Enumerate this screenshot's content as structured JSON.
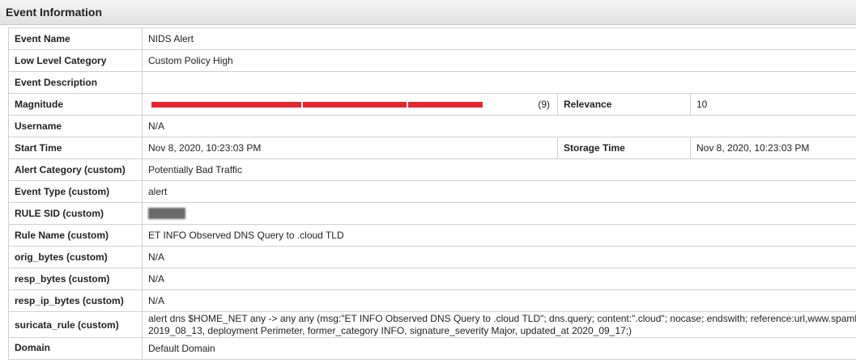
{
  "header": {
    "title": "Event Information"
  },
  "event": {
    "event_name_label": "Event Name",
    "event_name": "NIDS Alert",
    "low_level_category_label": "Low Level Category",
    "low_level_category": "Custom Policy High",
    "event_description_label": "Event Description",
    "event_description": "",
    "magnitude_label": "Magnitude",
    "magnitude_value": "(9)",
    "magnitude_level": 9,
    "magnitude_color": "#e8262e",
    "relevance_label": "Relevance",
    "relevance": "10",
    "username_label": "Username",
    "username": "N/A",
    "start_time_label": "Start Time",
    "start_time": "Nov 8, 2020, 10:23:03 PM",
    "storage_time_label": "Storage Time",
    "storage_time": "Nov 8, 2020, 10:23:03 PM",
    "alert_category_label": "Alert Category (custom)",
    "alert_category": "Potentially Bad Traffic",
    "event_type_label": "Event Type (custom)",
    "event_type": "alert",
    "rule_sid_label": "RULE SID (custom)",
    "rule_name_label": "Rule Name (custom)",
    "rule_name": "ET INFO Observed DNS Query to .cloud TLD",
    "orig_bytes_label": "orig_bytes (custom)",
    "orig_bytes": "N/A",
    "resp_bytes_label": "resp_bytes (custom)",
    "resp_bytes": "N/A",
    "resp_ip_bytes_label": "resp_ip_bytes (custom)",
    "resp_ip_bytes": "N/A",
    "suricata_rule_label": "suricata_rule (custom)",
    "suricata_rule_line1": "alert dns $HOME_NET any -> any any (msg:\"ET INFO Observed DNS Query to .cloud TLD\"; dns.query; content:\".cloud\"; nocase; endswith; reference:url,www.spamh",
    "suricata_rule_line2": "2019_08_13, deployment Perimeter, former_category INFO, signature_severity Major, updated_at 2020_09_17;)",
    "domain_label": "Domain",
    "domain": "Default Domain"
  }
}
